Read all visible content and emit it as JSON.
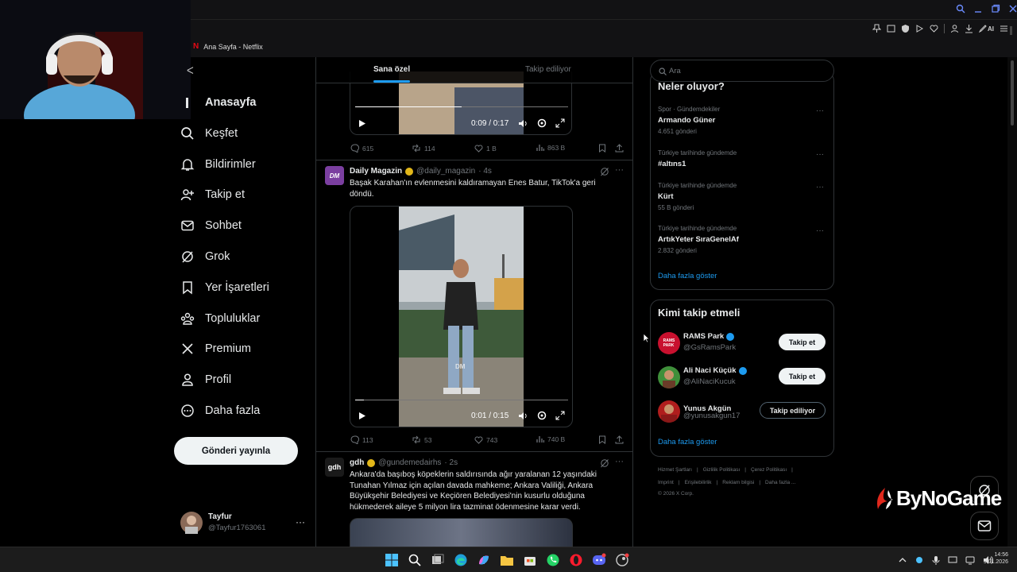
{
  "browser": {
    "tab_title": "Ana Sayfa - Netflix",
    "ai_label": "AI"
  },
  "nav": {
    "items": [
      {
        "label": "Anasayfa",
        "icon": "home-icon"
      },
      {
        "label": "Keşfet",
        "icon": "search-icon"
      },
      {
        "label": "Bildirimler",
        "icon": "bell-icon"
      },
      {
        "label": "Takip et",
        "icon": "person-add-icon"
      },
      {
        "label": "Sohbet",
        "icon": "mail-icon"
      },
      {
        "label": "Grok",
        "icon": "grok-icon"
      },
      {
        "label": "Yer İşaretleri",
        "icon": "bookmark-icon"
      },
      {
        "label": "Topluluklar",
        "icon": "communities-icon"
      },
      {
        "label": "Premium",
        "icon": "x-logo-icon"
      },
      {
        "label": "Profil",
        "icon": "profile-icon"
      },
      {
        "label": "Daha fazla",
        "icon": "more-circle-icon"
      }
    ],
    "post_button": "Gönderi yayınla"
  },
  "account": {
    "name": "Tayfur",
    "handle": "@Tayfur1763061"
  },
  "feed": {
    "tabs": [
      {
        "label": "Sana özel",
        "active": true
      },
      {
        "label": "Takip ediliyor",
        "active": false
      }
    ],
    "top_video": {
      "time": "0:09 / 0:17",
      "progress": 0.5,
      "actions": {
        "replies": "615",
        "reposts": "114",
        "likes": "1 B",
        "views": "863 B"
      }
    },
    "tweets": [
      {
        "name": "Daily Magazin",
        "handle": "@daily_magazin",
        "age": "· 4s",
        "avatar_text": "DM",
        "avatar_color": "#7b3fa0",
        "text_lines": [
          "Başak Karahan'ın evlenmesini kaldıramayan Enes Batur, TikTok'a geri",
          "döndü."
        ],
        "video": {
          "time": "0:01 / 0:15",
          "progress": 0.04,
          "watermark": "DM"
        },
        "actions": {
          "replies": "113",
          "reposts": "53",
          "likes": "743",
          "views": "740 B"
        }
      },
      {
        "name": "gdh",
        "handle": "@gundemedairhs",
        "age": "· 2s",
        "avatar_text": "gdh",
        "avatar_color": "#1a1a1a",
        "text_lines": [
          "Ankara'da başıboş köpeklerin saldırısında ağır yaralanan 12 yaşındaki",
          "Tunahan Yılmaz için açılan davada mahkeme; Ankara Valiliği, Ankara",
          "Büyükşehir Belediyesi ve Keçiören Belediyesi'nin kusurlu olduğuna",
          "hükmederek aileye 5 milyon lira tazminat ödenmesine karar verdi."
        ]
      }
    ]
  },
  "sidebar": {
    "search_placeholder": "Ara",
    "trends_title": "Neler oluyor?",
    "trends": [
      {
        "meta": "Spor · Gündemdekiler",
        "title": "Armando Güner",
        "count": "4.651 gönderi"
      },
      {
        "meta": "Türkiye tarihinde gündemde",
        "title": "#altıns1",
        "count": ""
      },
      {
        "meta": "Türkiye tarihinde gündemde",
        "title": "Kürt",
        "count": "55 B gönderi"
      },
      {
        "meta": "Türkiye tarihinde gündemde",
        "title": "ArtıkYeter SıraGenelAf",
        "count": "2.832 gönderi"
      }
    ],
    "show_more": "Daha fazla göster",
    "who_to_follow_title": "Kimi takip etmeli",
    "who_to_follow": [
      {
        "name": "RAMS Park",
        "handle": "@GsRamsPark",
        "button": "Takip et",
        "verified": true,
        "avatar_color": "#c8102e"
      },
      {
        "name": "Ali Naci Küçük",
        "handle": "@AliNaciKucuk",
        "button": "Takip et",
        "verified": true,
        "avatar_color": "#3f8f3a"
      },
      {
        "name": "Yunus Akgün",
        "handle": "@yunusakgun17",
        "button": "Takip ediliyor",
        "verified": false,
        "avatar_color": "#b01d1d"
      }
    ],
    "show_more_2": "Daha fazla göster",
    "footer": {
      "row1": [
        "Hizmet Şartları",
        "|",
        "Gizlilik Politikası",
        "|",
        "Çerez Politikası",
        "|"
      ],
      "row2": [
        "Imprint",
        "|",
        "Erişilebilirlik",
        "|",
        "Reklam bilgisi",
        "|",
        "Daha fazla ..."
      ],
      "copyright": "© 2026 X Corp."
    }
  },
  "overlay": {
    "watermark": "ByNoGame"
  },
  "taskbar": {
    "time": "14:56",
    "date": "9.01.2026"
  }
}
